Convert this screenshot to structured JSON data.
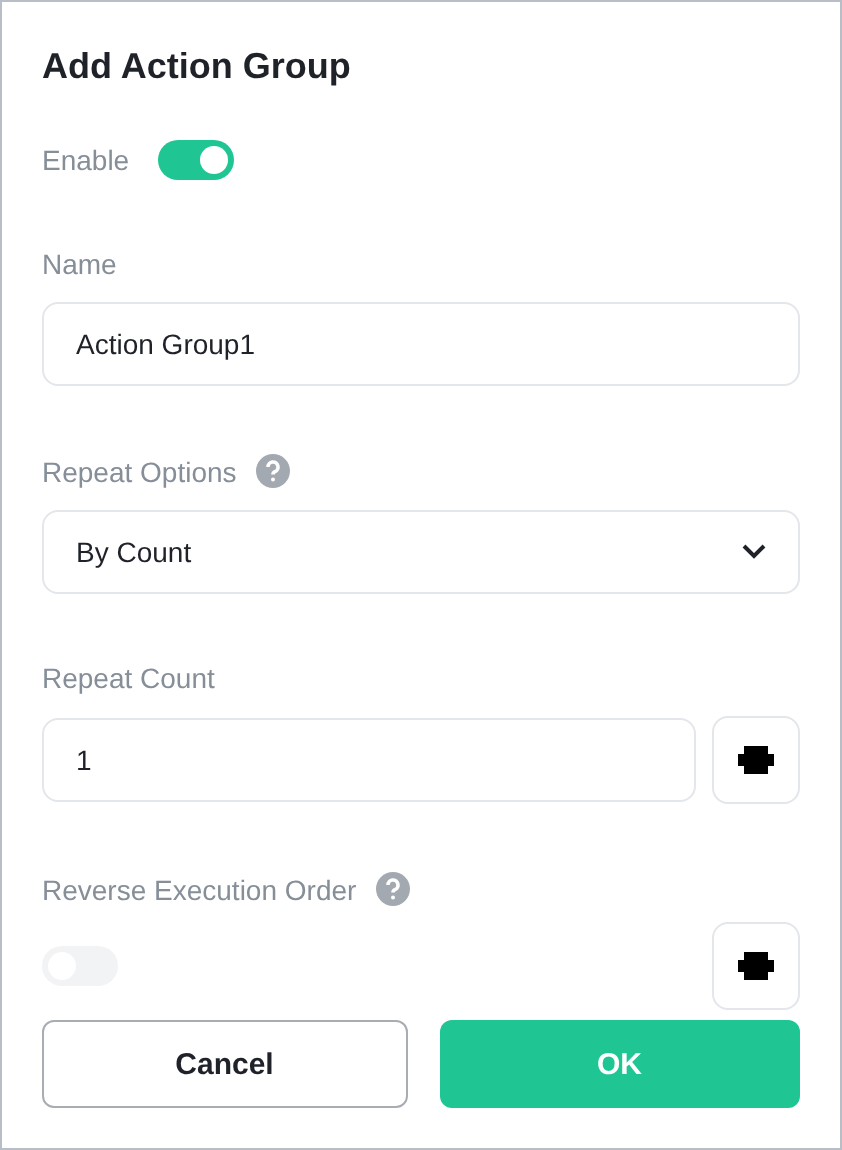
{
  "dialog": {
    "title": "Add Action Group"
  },
  "fields": [
    {
      "kind": "switch",
      "label": "Enable",
      "on": true,
      "disabled": false
    },
    {
      "kind": "text",
      "label": "Name",
      "value": "Action Group1"
    },
    {
      "kind": "select",
      "label": "Repeat Options",
      "help": true,
      "value": "By Count"
    },
    {
      "kind": "text",
      "label": "Repeat Count",
      "value": "1",
      "plugin": true
    },
    {
      "kind": "switch_block",
      "label": "Reverse Execution Order",
      "help": true,
      "on": false,
      "disabled": true,
      "plugin": true
    }
  ],
  "buttons": [
    {
      "label": "Cancel",
      "kind": "secondary"
    },
    {
      "label": "OK",
      "kind": "primary"
    }
  ]
}
